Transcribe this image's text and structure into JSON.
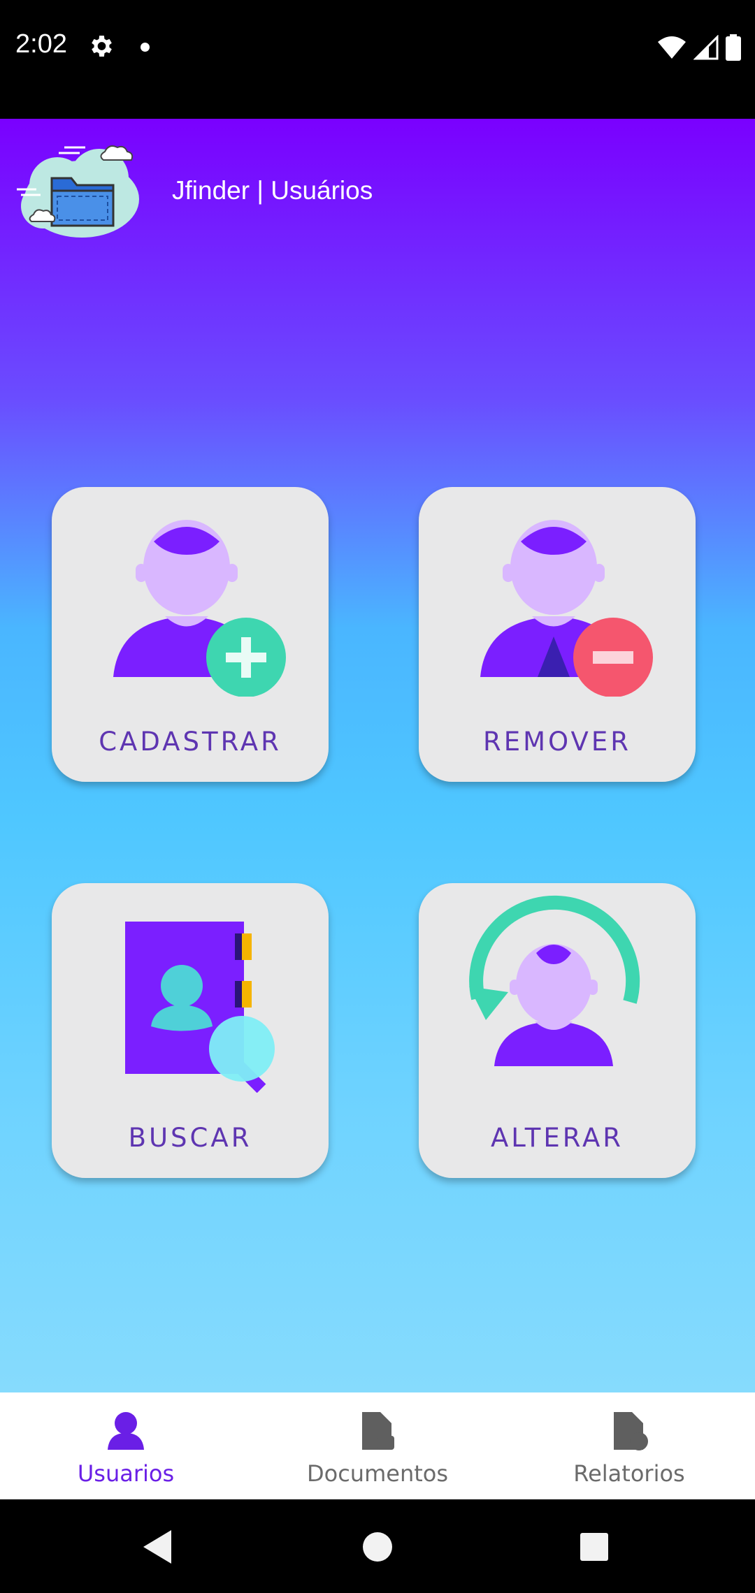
{
  "status_bar": {
    "time": "2:02"
  },
  "header": {
    "title": "Jfinder | Usuários",
    "logo_icon": "cloud-folder-icon"
  },
  "cards": [
    {
      "label": "CADASTRAR",
      "icon": "add-user-icon"
    },
    {
      "label": "REMOVER",
      "icon": "remove-user-icon"
    },
    {
      "label": "BUSCAR",
      "icon": "search-contact-book-icon"
    },
    {
      "label": "ALTERAR",
      "icon": "update-user-icon"
    }
  ],
  "bottom_nav": {
    "items": [
      {
        "label": "Usuarios",
        "icon": "person-icon",
        "active": true
      },
      {
        "label": "Documentos",
        "icon": "document-icon",
        "active": false
      },
      {
        "label": "Relatorios",
        "icon": "report-icon",
        "active": false
      }
    ]
  },
  "colors": {
    "accent": "#6a1fe6",
    "card_label": "#5e35b1",
    "card_background": "#e8e8e9",
    "gradient_top": "#7a00ff",
    "gradient_bottom": "#86dbfd",
    "add_green": "#3ed6b0",
    "remove_red": "#f5566e"
  }
}
